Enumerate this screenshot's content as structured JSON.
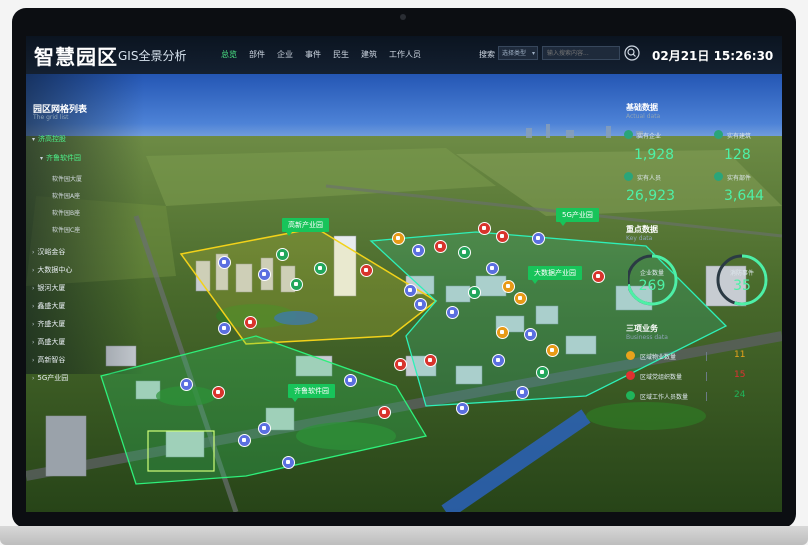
{
  "header": {
    "logo": "智慧园区",
    "subtitle": "GIS全景分析",
    "nav": [
      "总览",
      "部件",
      "企业",
      "事件",
      "民生",
      "建筑",
      "工作人员"
    ],
    "active_nav": 0,
    "search_label": "搜索",
    "search_select": "选择类型",
    "search_placeholder": "输入搜索内容...",
    "datetime": "02月21日 15:26:30"
  },
  "left_panel": {
    "title": "园区网格列表",
    "subtitle": "The grid list",
    "tree": [
      {
        "label": "济高控股",
        "level": 1,
        "arrow": "▾",
        "selected": true
      },
      {
        "label": "齐鲁软件园",
        "level": 1,
        "arrow": "▾",
        "selected": true
      },
      {
        "label": "软件园大厦",
        "level": 2
      },
      {
        "label": "软件园A座",
        "level": 2
      },
      {
        "label": "软件园B座",
        "level": 2
      },
      {
        "label": "软件园C座",
        "level": 2
      },
      {
        "label": "汉峪金谷",
        "level": 1,
        "arrow": "›"
      },
      {
        "label": "大数据中心",
        "level": 1,
        "arrow": "›"
      },
      {
        "label": "银河大厦",
        "level": 1,
        "arrow": "›"
      },
      {
        "label": "鑫盛大厦",
        "level": 1,
        "arrow": "›"
      },
      {
        "label": "齐盛大厦",
        "level": 1,
        "arrow": "›"
      },
      {
        "label": "高盛大厦",
        "level": 1,
        "arrow": "›"
      },
      {
        "label": "高新智谷",
        "level": 1,
        "arrow": "›"
      },
      {
        "label": "5G产业园",
        "level": 1,
        "arrow": "›"
      }
    ]
  },
  "right_panel": {
    "basic": {
      "title": "基础数据",
      "subtitle": "Actual data",
      "stats": [
        {
          "label": "实有企业",
          "value": "1,928",
          "icon": "building-icon"
        },
        {
          "label": "实有建筑",
          "value": "128",
          "icon": "tower-icon"
        },
        {
          "label": "实有人员",
          "value": "26,923",
          "icon": "person-icon"
        },
        {
          "label": "实有部件",
          "value": "3,644",
          "icon": "part-icon"
        }
      ]
    },
    "key": {
      "title": "重点数据",
      "subtitle": "Key data",
      "rings": [
        {
          "label": "企业数量",
          "value": "269",
          "fraction": 0.72
        },
        {
          "label": "消防事件",
          "value": "35",
          "fraction": 0.55
        }
      ]
    },
    "business": {
      "title": "三项业务",
      "subtitle": "Business data",
      "items": [
        {
          "label": "区域物业数量",
          "value": "11",
          "color": "#e8a31c"
        },
        {
          "label": "区域党组织数量",
          "value": "15",
          "color": "#e03131"
        },
        {
          "label": "区域工作人员数量",
          "value": "24",
          "color": "#20b45a"
        }
      ]
    }
  },
  "map": {
    "zones": [
      {
        "name": "高新产业园"
      },
      {
        "name": "5G产业园"
      },
      {
        "name": "大数据产业园"
      },
      {
        "name": "齐鲁软件园"
      }
    ]
  },
  "colors": {
    "accent": "#4ef08a",
    "zone_green": "#18c45a",
    "zone_yellow": "#f2d21a",
    "marker_blue": "#5b6fe0",
    "marker_red": "#d8342c",
    "marker_green": "#22a65b",
    "marker_orange": "#e89a16"
  }
}
